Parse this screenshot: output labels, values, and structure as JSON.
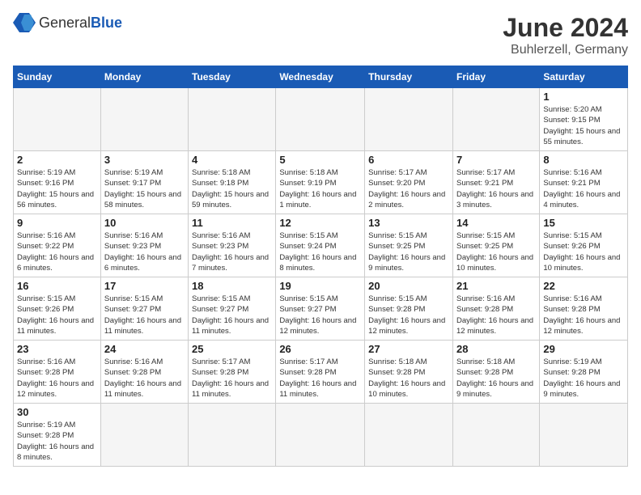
{
  "header": {
    "logo_text_normal": "General",
    "logo_text_bold": "Blue",
    "title": "June 2024",
    "subtitle": "Buhlerzell, Germany"
  },
  "days_of_week": [
    "Sunday",
    "Monday",
    "Tuesday",
    "Wednesday",
    "Thursday",
    "Friday",
    "Saturday"
  ],
  "weeks": [
    [
      {
        "day": "",
        "info": ""
      },
      {
        "day": "",
        "info": ""
      },
      {
        "day": "",
        "info": ""
      },
      {
        "day": "",
        "info": ""
      },
      {
        "day": "",
        "info": ""
      },
      {
        "day": "",
        "info": ""
      },
      {
        "day": "1",
        "info": "Sunrise: 5:20 AM\nSunset: 9:15 PM\nDaylight: 15 hours and 55 minutes."
      }
    ],
    [
      {
        "day": "2",
        "info": "Sunrise: 5:19 AM\nSunset: 9:16 PM\nDaylight: 15 hours and 56 minutes."
      },
      {
        "day": "3",
        "info": "Sunrise: 5:19 AM\nSunset: 9:17 PM\nDaylight: 15 hours and 58 minutes."
      },
      {
        "day": "4",
        "info": "Sunrise: 5:18 AM\nSunset: 9:18 PM\nDaylight: 15 hours and 59 minutes."
      },
      {
        "day": "5",
        "info": "Sunrise: 5:18 AM\nSunset: 9:19 PM\nDaylight: 16 hours and 1 minute."
      },
      {
        "day": "6",
        "info": "Sunrise: 5:17 AM\nSunset: 9:20 PM\nDaylight: 16 hours and 2 minutes."
      },
      {
        "day": "7",
        "info": "Sunrise: 5:17 AM\nSunset: 9:21 PM\nDaylight: 16 hours and 3 minutes."
      },
      {
        "day": "8",
        "info": "Sunrise: 5:16 AM\nSunset: 9:21 PM\nDaylight: 16 hours and 4 minutes."
      }
    ],
    [
      {
        "day": "9",
        "info": "Sunrise: 5:16 AM\nSunset: 9:22 PM\nDaylight: 16 hours and 6 minutes."
      },
      {
        "day": "10",
        "info": "Sunrise: 5:16 AM\nSunset: 9:23 PM\nDaylight: 16 hours and 6 minutes."
      },
      {
        "day": "11",
        "info": "Sunrise: 5:16 AM\nSunset: 9:23 PM\nDaylight: 16 hours and 7 minutes."
      },
      {
        "day": "12",
        "info": "Sunrise: 5:15 AM\nSunset: 9:24 PM\nDaylight: 16 hours and 8 minutes."
      },
      {
        "day": "13",
        "info": "Sunrise: 5:15 AM\nSunset: 9:25 PM\nDaylight: 16 hours and 9 minutes."
      },
      {
        "day": "14",
        "info": "Sunrise: 5:15 AM\nSunset: 9:25 PM\nDaylight: 16 hours and 10 minutes."
      },
      {
        "day": "15",
        "info": "Sunrise: 5:15 AM\nSunset: 9:26 PM\nDaylight: 16 hours and 10 minutes."
      }
    ],
    [
      {
        "day": "16",
        "info": "Sunrise: 5:15 AM\nSunset: 9:26 PM\nDaylight: 16 hours and 11 minutes."
      },
      {
        "day": "17",
        "info": "Sunrise: 5:15 AM\nSunset: 9:27 PM\nDaylight: 16 hours and 11 minutes."
      },
      {
        "day": "18",
        "info": "Sunrise: 5:15 AM\nSunset: 9:27 PM\nDaylight: 16 hours and 11 minutes."
      },
      {
        "day": "19",
        "info": "Sunrise: 5:15 AM\nSunset: 9:27 PM\nDaylight: 16 hours and 12 minutes."
      },
      {
        "day": "20",
        "info": "Sunrise: 5:15 AM\nSunset: 9:28 PM\nDaylight: 16 hours and 12 minutes."
      },
      {
        "day": "21",
        "info": "Sunrise: 5:16 AM\nSunset: 9:28 PM\nDaylight: 16 hours and 12 minutes."
      },
      {
        "day": "22",
        "info": "Sunrise: 5:16 AM\nSunset: 9:28 PM\nDaylight: 16 hours and 12 minutes."
      }
    ],
    [
      {
        "day": "23",
        "info": "Sunrise: 5:16 AM\nSunset: 9:28 PM\nDaylight: 16 hours and 12 minutes."
      },
      {
        "day": "24",
        "info": "Sunrise: 5:16 AM\nSunset: 9:28 PM\nDaylight: 16 hours and 11 minutes."
      },
      {
        "day": "25",
        "info": "Sunrise: 5:17 AM\nSunset: 9:28 PM\nDaylight: 16 hours and 11 minutes."
      },
      {
        "day": "26",
        "info": "Sunrise: 5:17 AM\nSunset: 9:28 PM\nDaylight: 16 hours and 11 minutes."
      },
      {
        "day": "27",
        "info": "Sunrise: 5:18 AM\nSunset: 9:28 PM\nDaylight: 16 hours and 10 minutes."
      },
      {
        "day": "28",
        "info": "Sunrise: 5:18 AM\nSunset: 9:28 PM\nDaylight: 16 hours and 9 minutes."
      },
      {
        "day": "29",
        "info": "Sunrise: 5:19 AM\nSunset: 9:28 PM\nDaylight: 16 hours and 9 minutes."
      }
    ],
    [
      {
        "day": "30",
        "info": "Sunrise: 5:19 AM\nSunset: 9:28 PM\nDaylight: 16 hours and 8 minutes."
      },
      {
        "day": "",
        "info": ""
      },
      {
        "day": "",
        "info": ""
      },
      {
        "day": "",
        "info": ""
      },
      {
        "day": "",
        "info": ""
      },
      {
        "day": "",
        "info": ""
      },
      {
        "day": "",
        "info": ""
      }
    ]
  ]
}
